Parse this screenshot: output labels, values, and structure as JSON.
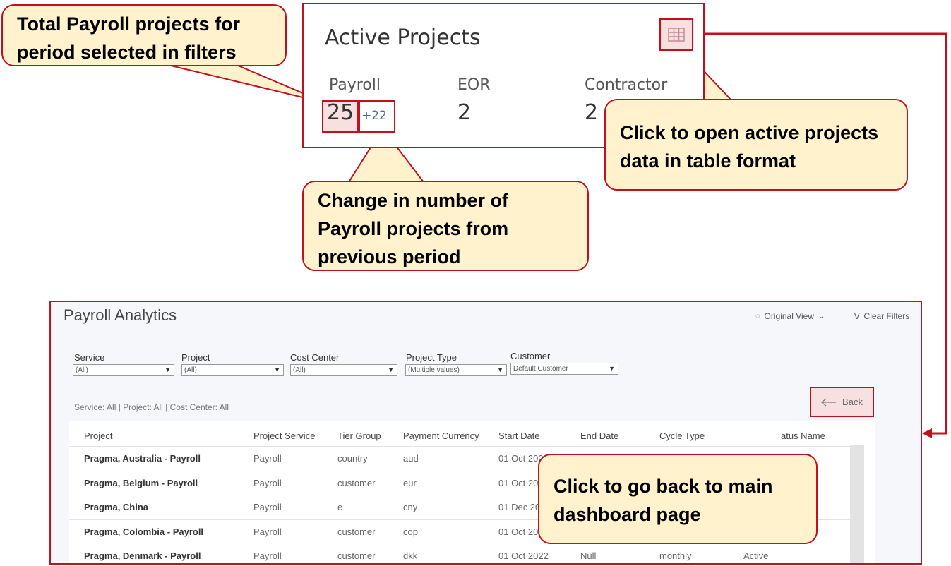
{
  "card": {
    "title": "Active Projects",
    "metrics": [
      {
        "label": "Payroll",
        "value": "25",
        "change": "+22"
      },
      {
        "label": "EOR",
        "value": "2"
      },
      {
        "label": "Contractor",
        "value": "2"
      }
    ],
    "table_icon": "table-grid-icon"
  },
  "callouts": {
    "total": "Total Payroll projects for period selected in filters",
    "table": "Click to open active projects data in table format",
    "change": "Change in number of Payroll projects from previous period",
    "back": "Click to go back to main dashboard page"
  },
  "dashboard": {
    "title": "Payroll Analytics",
    "original_view": "Original View",
    "clear_filters": "Clear Filters",
    "filters": [
      {
        "label": "Service",
        "value": "(All)"
      },
      {
        "label": "Project",
        "value": "(All)"
      },
      {
        "label": "Cost Center",
        "value": "(All)"
      },
      {
        "label": "Project Type",
        "value": "(Multiple values)"
      },
      {
        "label": "Customer",
        "value": "Default Customer"
      }
    ],
    "applied_filters": "Service: All | Project: All | Cost Center: All",
    "back_label": "Back",
    "columns": [
      "Project",
      "Project Service",
      "Tier Group",
      "Payment Currency",
      "Start Date",
      "End Date",
      "Cycle Type",
      "atus Name"
    ],
    "rows": [
      [
        "Pragma, Australia - Payroll",
        "Payroll",
        "country",
        "aud",
        "01 Oct 2022",
        "",
        "",
        ""
      ],
      [
        "Pragma, Belgium - Payroll",
        "Payroll",
        "customer",
        "eur",
        "01 Oct 20",
        "",
        "",
        ""
      ],
      [
        "Pragma, China",
        "Payroll",
        "e",
        "cny",
        "01 Dec 20",
        "",
        "",
        ""
      ],
      [
        "Pragma, Colombia - Payroll",
        "Payroll",
        "customer",
        "cop",
        "01 Oct 20",
        "",
        "",
        ""
      ],
      [
        "Pragma, Denmark - Payroll",
        "Payroll",
        "customer",
        "dkk",
        "01 Oct 2022",
        "Null",
        "monthly",
        "Active"
      ]
    ]
  },
  "colors": {
    "accent": "#c0121d",
    "callout_fill": "#fff2cc",
    "highlight_fill": "#f8dfe0"
  }
}
